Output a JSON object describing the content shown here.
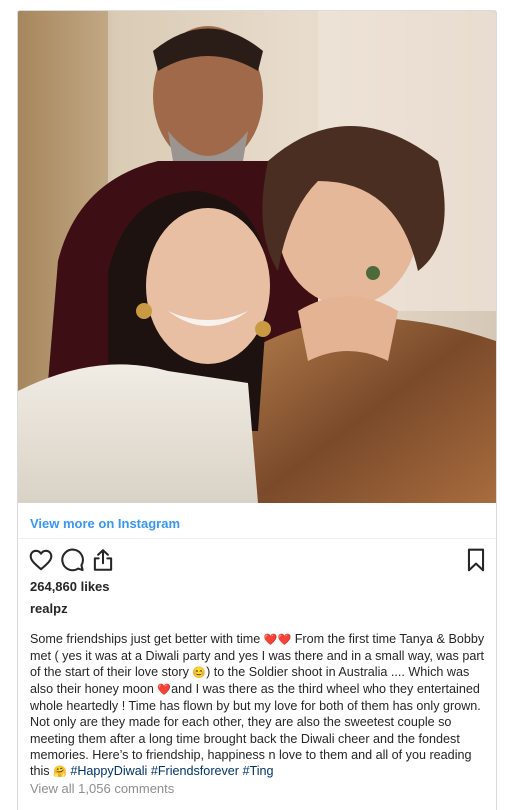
{
  "post": {
    "view_more_label": "View more on Instagram",
    "likes": "264,860 likes",
    "username": "realpz",
    "caption": {
      "part1": "Some friendships just get better with time ",
      "emoji_hearts": "❤️❤️",
      "part2": " From the first time Tanya & Bobby met ( yes it was at a Diwali party and yes I was there and in a small way, was part of the start of their love story ",
      "emoji_grin": "😊",
      "part3": ") to the Soldier shoot in Australia .... Which was also their honey moon ",
      "emoji_heart": "❤️",
      "part4": "and I was there as the third wheel who they entertained whole heartedly ! Time has flown by but my love for both of them has only grown. Not only are they made for each other, they are also the sweetest couple so meeting them after a long time brought back the Diwali cheer and the fondest memories. Here’s to friendship, happiness n love to them and all of you reading this ",
      "emoji_hug": "🤗",
      "hashtags": [
        "#HappyDiwali",
        "#Friendsforever",
        "#Ting"
      ]
    },
    "comments_label": "View all 1,056 comments"
  },
  "icons": {
    "like": "heart-outline-icon",
    "comment": "comment-bubble-icon",
    "share": "share-upload-icon",
    "save": "bookmark-icon"
  },
  "colors": {
    "link_blue": "#3897f0",
    "hashtag_blue": "#003569",
    "muted_gray": "#8e8e8e",
    "text": "#262626"
  }
}
